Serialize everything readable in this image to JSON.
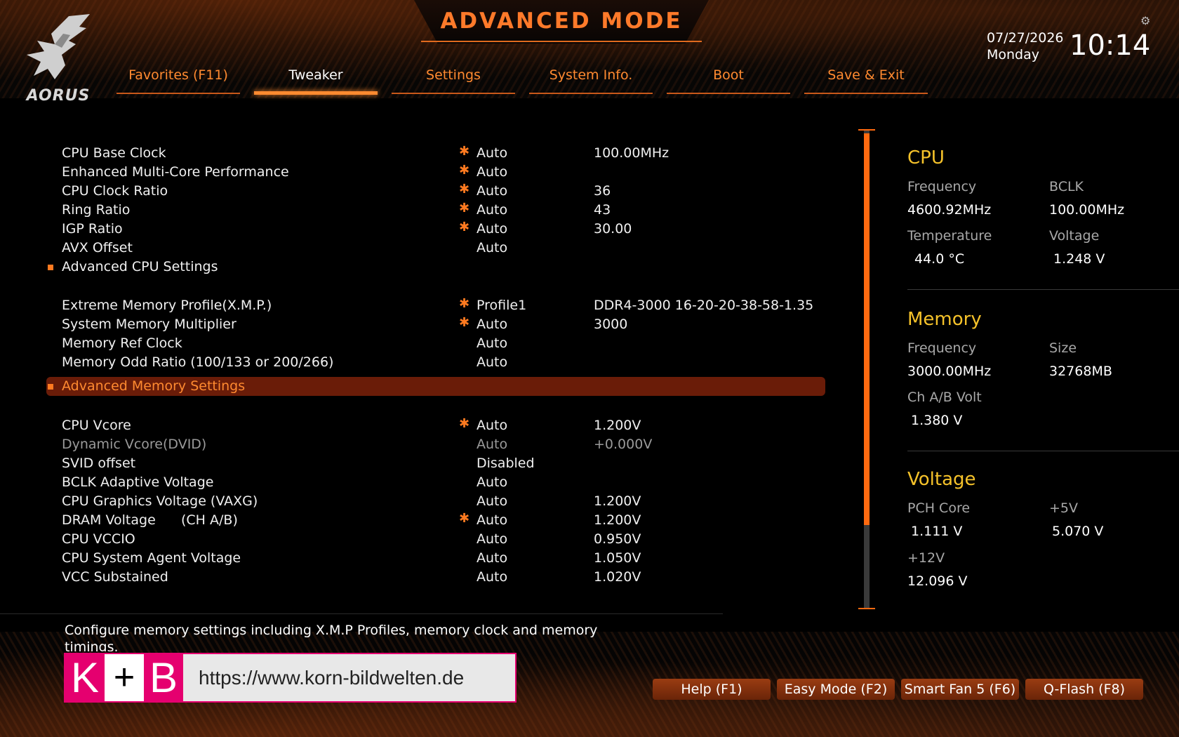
{
  "header": {
    "title": "ADVANCED MODE",
    "logo_text": "AORUS",
    "date": "07/27/2026",
    "day": "Monday",
    "time": "10:14",
    "gear_icon": "gear-icon"
  },
  "tabs": [
    {
      "label": "Favorites (F11)",
      "active": false
    },
    {
      "label": "Tweaker",
      "active": true
    },
    {
      "label": "Settings",
      "active": false
    },
    {
      "label": "System Info.",
      "active": false
    },
    {
      "label": "Boot",
      "active": false
    },
    {
      "label": "Save & Exit",
      "active": false
    }
  ],
  "settings": [
    {
      "name": "CPU Base Clock",
      "star": "✱",
      "option": "Auto",
      "value": "100.00MHz"
    },
    {
      "name": "Enhanced Multi-Core Performance",
      "star": "✱",
      "option": "Auto",
      "value": ""
    },
    {
      "name": "CPU Clock Ratio",
      "star": "✱",
      "option": "Auto",
      "value": "36"
    },
    {
      "name": "Ring Ratio",
      "star": "✱",
      "option": "Auto",
      "value": "43"
    },
    {
      "name": "IGP Ratio",
      "star": "✱",
      "option": "Auto",
      "value": "30.00"
    },
    {
      "name": "AVX Offset",
      "star": "",
      "option": "Auto",
      "value": ""
    },
    {
      "name": "Advanced CPU Settings",
      "submenu": true
    },
    {
      "name": "Extreme Memory Profile(X.M.P.)",
      "star": "✱",
      "option": "Profile1",
      "value": "DDR4-3000 16-20-20-38-58-1.35"
    },
    {
      "name": "System Memory Multiplier",
      "star": "✱",
      "option": "Auto",
      "value": "3000"
    },
    {
      "name": "Memory Ref Clock",
      "star": "",
      "option": "Auto",
      "value": ""
    },
    {
      "name": "Memory Odd Ratio (100/133 or 200/266)",
      "star": "",
      "option": "Auto",
      "value": ""
    },
    {
      "name": "Advanced Memory Settings",
      "submenu": true,
      "selected": true
    },
    {
      "name": "CPU Vcore",
      "star": "✱",
      "option": "Auto",
      "value": "1.200V"
    },
    {
      "name": "Dynamic Vcore(DVID)",
      "star": "",
      "option": "Auto",
      "value": "+0.000V",
      "dim": true
    },
    {
      "name": "SVID offset",
      "star": "",
      "option": "Disabled",
      "value": ""
    },
    {
      "name": "BCLK Adaptive Voltage",
      "star": "",
      "option": "Auto",
      "value": ""
    },
    {
      "name": "CPU Graphics Voltage (VAXG)",
      "star": "",
      "option": "Auto",
      "value": "1.200V"
    },
    {
      "name": "DRAM Voltage      (CH A/B)",
      "star": "✱",
      "option": "Auto",
      "value": "1.200V"
    },
    {
      "name": "CPU VCCIO",
      "star": "",
      "option": "Auto",
      "value": "0.950V"
    },
    {
      "name": "CPU System Agent Voltage",
      "star": "",
      "option": "Auto",
      "value": "1.050V"
    },
    {
      "name": "VCC Substained",
      "star": "",
      "option": "Auto",
      "value": "1.020V"
    }
  ],
  "scroll": {
    "thumb_fraction": 0.82
  },
  "panel": {
    "cpu": {
      "title": "CPU",
      "freq_label": "Frequency",
      "freq": "4600.92MHz",
      "bclk_label": "BCLK",
      "bclk": "100.00MHz",
      "temp_label": "Temperature",
      "temp": "44.0 °C",
      "volt_label": "Voltage",
      "volt": "1.248 V"
    },
    "memory": {
      "title": "Memory",
      "freq_label": "Frequency",
      "freq": "3000.00MHz",
      "size_label": "Size",
      "size": "32768MB",
      "chvolt_label": "Ch A/B Volt",
      "chvolt": "1.380 V"
    },
    "voltage": {
      "title": "Voltage",
      "pch_label": "PCH Core",
      "pch": "1.111 V",
      "p5_label": "+5V",
      "p5": "5.070 V",
      "p12_label": "+12V",
      "p12": "12.096 V"
    }
  },
  "description": "Configure memory settings including X.M.P Profiles, memory clock and memory timings.",
  "watermark": {
    "k": "K",
    "plus": "+",
    "b": "B",
    "url": "https://www.korn-bildwelten.de"
  },
  "footer_buttons": [
    {
      "label": "Help (F1)"
    },
    {
      "label": "Easy Mode (F2)"
    },
    {
      "label": "Smart Fan 5 (F6)"
    },
    {
      "label": "Q-Flash (F8)"
    }
  ],
  "colors": {
    "accent": "#ff7a2a",
    "section_title": "#f5c22a",
    "selected_row": "#6a1c08"
  }
}
